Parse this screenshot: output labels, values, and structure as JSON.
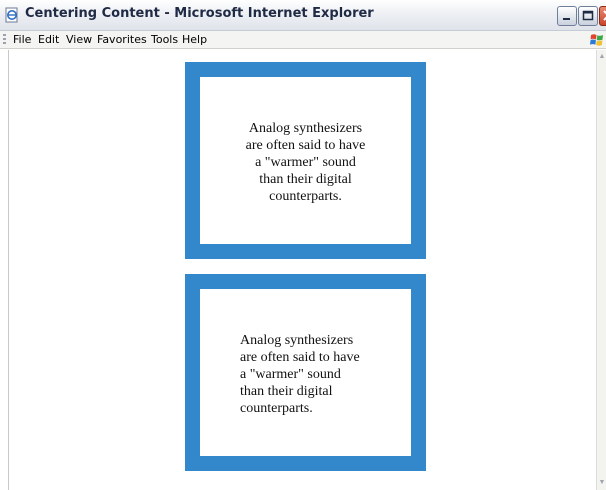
{
  "window": {
    "title": "Centering Content - Microsoft Internet Explorer"
  },
  "menu": {
    "items": [
      "File",
      "Edit",
      "View",
      "Favorites",
      "Tools",
      "Help"
    ]
  },
  "boxes": [
    {
      "alignment": "center",
      "lines": [
        "Analog synthesizers",
        "are often said to have",
        "a \"warmer\" sound",
        "than their digital",
        "counterparts."
      ]
    },
    {
      "alignment": "left",
      "lines": [
        "Analog synthesizers",
        "are often said to have",
        "a \"warmer\" sound",
        "than their digital",
        "counterparts."
      ]
    }
  ],
  "colors": {
    "box_border": "#3388cc",
    "page_background": "#ffffff"
  },
  "icons": {
    "app": "ie-page-icon",
    "logo": "windows-flag-icon"
  }
}
